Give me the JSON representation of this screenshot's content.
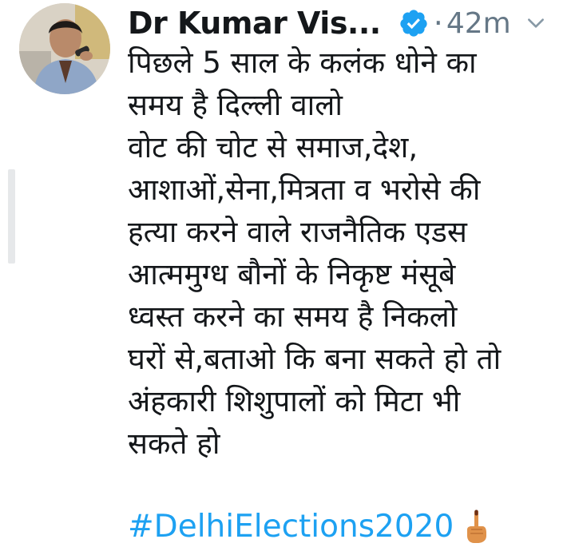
{
  "tweet": {
    "author_name": "Dr Kumar Vis...",
    "separator": "·",
    "timestamp": "42m",
    "lines": [
      "पिछले 5 साल के कलंक धोने का",
      "समय है दिल्ली वालो",
      "वोट की चोट से समाज,देश,",
      "आशाओं,सेना,मित्रता व भरोसे की",
      "हत्या करने वाले राजनैतिक एडस",
      "आत्ममुग्ध बौनों के निकृष्ट मंसूबे",
      "ध्वस्त करने का समय है निकलो",
      "घरों से,बताओ कि बना सकते हो तो",
      "अंहकारी शिशुपालों को मिटा भी",
      "सकते हो"
    ],
    "hashtag": "#DelhiElections2020"
  },
  "icons": {
    "verified": "verified-badge-icon",
    "menu": "chevron-down-icon",
    "emoji": "inked-finger-emoji-icon"
  },
  "colors": {
    "link": "#1da1f2",
    "verified": "#1da1f2",
    "muted": "#657786",
    "text": "#14171a"
  }
}
